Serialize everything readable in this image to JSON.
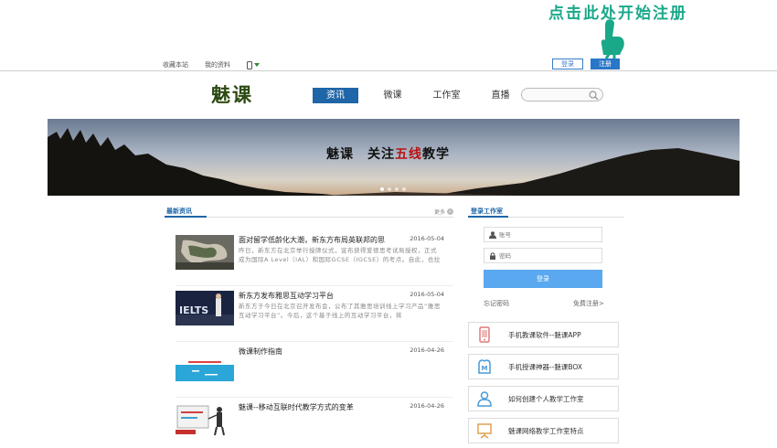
{
  "annotation": {
    "text": "点击此处开始注册",
    "color": "#1aa889"
  },
  "topbar": {
    "links": [
      "收藏本站",
      "我的资料"
    ],
    "phone_icon": "phone-icon",
    "login_label": "登录",
    "register_label": "注册"
  },
  "header": {
    "logo": "魅课",
    "nav": [
      {
        "label": "资讯",
        "active": true
      },
      {
        "label": "微课",
        "active": false
      },
      {
        "label": "工作室",
        "active": false
      },
      {
        "label": "直播",
        "active": false
      }
    ],
    "search": {
      "placeholder": "",
      "icon": "search-icon"
    }
  },
  "banner": {
    "text_before": "魅课　关注",
    "text_highlight": "五线",
    "text_after": "教学",
    "slides": 4,
    "active_slide": 1
  },
  "news": {
    "section_title": "最新资讯",
    "more_label": "更多",
    "items": [
      {
        "title": "面对留学低龄化大潮，新东方布局英联邦的思",
        "date": "2016-05-04",
        "desc": "昨日，新东方在北京举行授牌仪式，宣布获得爱德思考试局授权，正式成为国际A Level（IAL）和国际GCSE（IGCSE）的考点。自此，也拉",
        "thumb": "aerial-photo"
      },
      {
        "title": "新东方发布雅思互动学习平台",
        "date": "2016-05-04",
        "desc": "新东方于今日在北京召开发布会，公布了其雅思培训线上学习产品“雅思互动学习平台”。今后，这个基于线上的互动学习平台，将",
        "thumb": "ielts-stage-photo"
      },
      {
        "title": "微课制作指南",
        "date": "2016-04-26",
        "desc": "",
        "thumb": "blue-slide-photo"
      },
      {
        "title": "魅课--移动互联时代教学方式的变革",
        "date": "2016-04-26",
        "desc": "",
        "thumb": "presentation-photo"
      }
    ]
  },
  "login_panel": {
    "title": "登录工作室",
    "username_placeholder": "账号",
    "password_placeholder": "密码",
    "submit_label": "登录",
    "forgot_label": "忘记密码",
    "register_label": "免费注册>"
  },
  "features": [
    {
      "label": "手机教课软件--魅课APP",
      "icon": "phone-app-icon",
      "color": "#e07a7a"
    },
    {
      "label": "手机授课神器--魅课BOX",
      "icon": "box-icon",
      "color": "#4a9ad6"
    },
    {
      "label": "如何创建个人教学工作室",
      "icon": "user-icon",
      "color": "#4a9ad6"
    },
    {
      "label": "魅课网络教学工作室特点",
      "icon": "presentation-icon",
      "color": "#e0a050"
    }
  ]
}
